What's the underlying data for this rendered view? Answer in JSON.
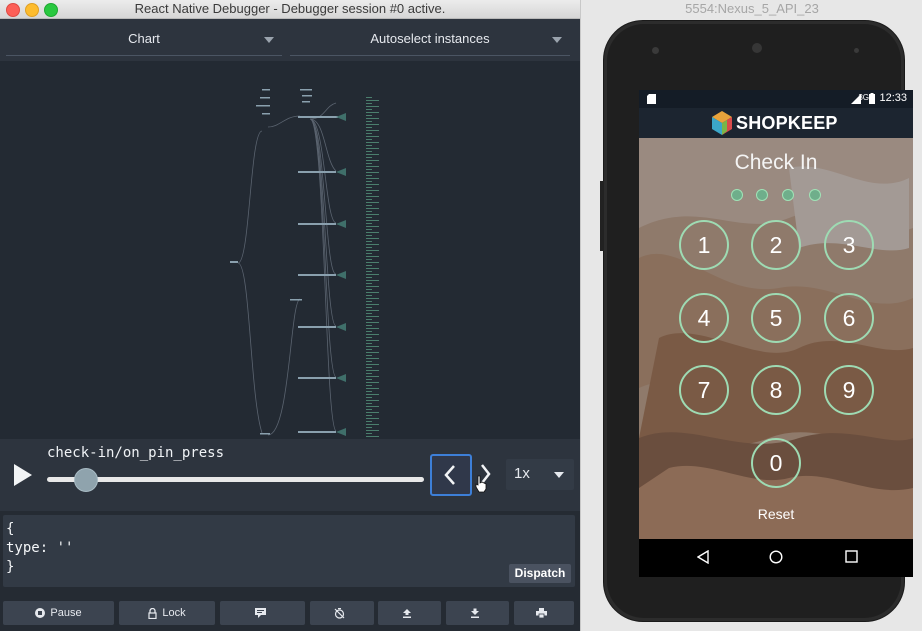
{
  "window": {
    "title": "React Native Debugger - Debugger session #0 active."
  },
  "toolbar": {
    "monitor_select": "Chart",
    "instance_select": "Autoselect instances"
  },
  "slider": {
    "action_name": "check-in/on_pin_press",
    "speed": "1x",
    "position_fraction": 0.1
  },
  "dispatcher": {
    "code": "{\ntype: ''\n}",
    "dispatch_label": "Dispatch"
  },
  "bottom_buttons": {
    "pause_label": "Pause",
    "lock_label": "Lock"
  },
  "emulator": {
    "title": "5554:Nexus_5_API_23",
    "status_time": "12:33",
    "status_signal": "3G",
    "brand": "SHOPKEEP",
    "heading": "Check In",
    "keys": [
      "1",
      "2",
      "3",
      "4",
      "5",
      "6",
      "7",
      "8",
      "9",
      "0"
    ],
    "reset_label": "Reset"
  },
  "colors": {
    "debugger_bg": "#252b33",
    "accent_focus": "#3d7fd8",
    "pin_ring": "#9edbb3"
  }
}
